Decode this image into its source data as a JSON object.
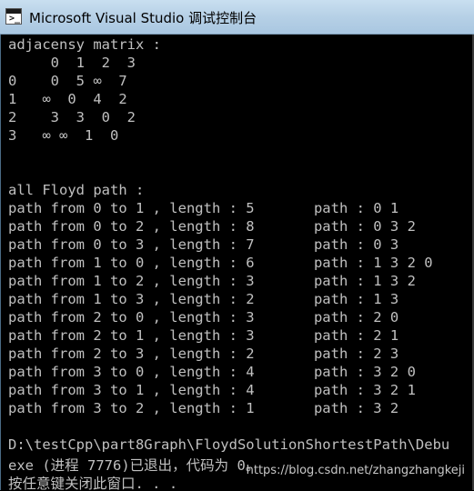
{
  "window": {
    "title": "Microsoft Visual Studio 调试控制台",
    "icon": "console-window-icon"
  },
  "console": {
    "lines": [
      "adjacensy matrix :",
      "     0  1  2  3",
      "0    0  5 ∞  7",
      "1   ∞  0  4  2",
      "2    3  3  0  2",
      "3   ∞ ∞  1  0",
      "",
      "",
      "all Floyd path :",
      "path from 0 to 1 , length : 5       path : 0 1",
      "path from 0 to 2 , length : 8       path : 0 3 2",
      "path from 0 to 3 , length : 7       path : 0 3",
      "path from 1 to 0 , length : 6       path : 1 3 2 0",
      "path from 1 to 2 , length : 3       path : 1 3 2",
      "path from 1 to 3 , length : 2       path : 1 3",
      "path from 2 to 0 , length : 3       path : 2 0",
      "path from 2 to 1 , length : 3       path : 2 1",
      "path from 2 to 3 , length : 2       path : 2 3",
      "path from 3 to 0 , length : 4       path : 3 2 0",
      "path from 3 to 1 , length : 4       path : 3 2 1",
      "path from 3 to 2 , length : 1       path : 3 2",
      "",
      "D:\\testCpp\\part8Graph\\FloydSolutionShortestPath\\Debu",
      "exe (进程 7776)已退出，代码为 0。",
      "按任意键关闭此窗口. . ."
    ],
    "watermark": "https://blog.csdn.net/zhangzhangkeji"
  }
}
